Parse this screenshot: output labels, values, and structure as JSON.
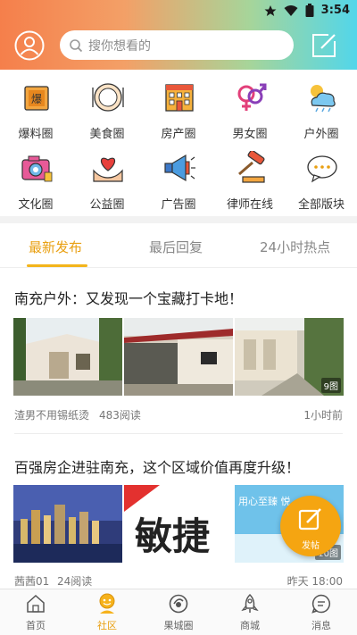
{
  "status": {
    "time": "3:54"
  },
  "search": {
    "placeholder": "搜你想看的"
  },
  "categories": [
    {
      "label": "爆料圈",
      "icon": "scoop-icon"
    },
    {
      "label": "美食圈",
      "icon": "food-plate-icon"
    },
    {
      "label": "房产圈",
      "icon": "building-icon"
    },
    {
      "label": "男女圈",
      "icon": "gender-icon"
    },
    {
      "label": "户外圈",
      "icon": "weather-cloud-icon"
    },
    {
      "label": "文化圈",
      "icon": "camera-icon"
    },
    {
      "label": "公益圈",
      "icon": "heart-hands-icon"
    },
    {
      "label": "广告圈",
      "icon": "megaphone-icon"
    },
    {
      "label": "律师在线",
      "icon": "gavel-icon"
    },
    {
      "label": "全部版块",
      "icon": "more-bubble-icon"
    }
  ],
  "tabs": [
    {
      "label": "最新发布",
      "active": true
    },
    {
      "label": "最后回复",
      "active": false
    },
    {
      "label": "24小时热点",
      "active": false
    }
  ],
  "posts": [
    {
      "title": "南充户外：又发现一个宝藏打卡地！",
      "author": "渣男不用锡纸烫",
      "reads": "483阅读",
      "time": "1小时前",
      "photo_count": "9图"
    },
    {
      "title": "百强房企进驻南充，这个区域价值再度升级！",
      "author": "茜茜01",
      "reads": "24阅读",
      "time": "昨天 18:00",
      "photo_count": "10图",
      "photo2_text": "敏捷",
      "photo3_text": "用心至臻  悦"
    }
  ],
  "fab": {
    "label": "发帖"
  },
  "bottom_nav": [
    {
      "label": "首页",
      "icon": "home-icon",
      "active": false
    },
    {
      "label": "社区",
      "icon": "community-icon",
      "active": true
    },
    {
      "label": "果城圈",
      "icon": "circle-icon",
      "active": false
    },
    {
      "label": "商城",
      "icon": "rocket-icon",
      "active": false
    },
    {
      "label": "消息",
      "icon": "message-icon",
      "active": false
    }
  ]
}
